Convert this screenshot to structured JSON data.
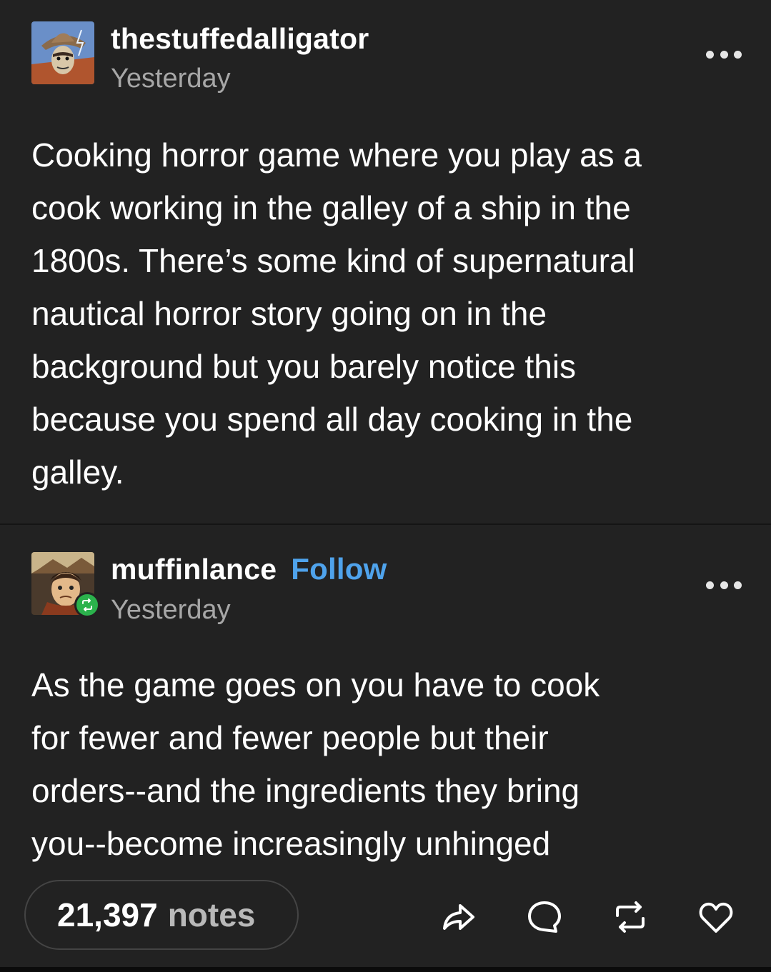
{
  "posts": [
    {
      "username": "thestuffedalligator",
      "timestamp": "Yesterday",
      "avatar_icon": "cowboy-avatar",
      "body": "Cooking horror game where you play as a\ncook working in the galley of a ship in the\n1800s. There’s some kind of supernatural\nnautical horror story going on in the\nbackground but you barely notice this\nbecause you spend all day cooking in the\ngalley."
    },
    {
      "username": "muffinlance",
      "follow_label": "Follow",
      "timestamp": "Yesterday",
      "avatar_icon": "cartoon-character-avatar",
      "badge_icon": "reblog-badge-icon",
      "body": "As the game goes on you have to cook\nfor fewer and fewer people but their\norders--and the ingredients they bring\nyou--become increasingly unhinged"
    }
  ],
  "footer": {
    "notes_count": "21,397",
    "notes_label": "notes",
    "actions": [
      "share-icon",
      "reply-icon",
      "reblog-icon",
      "like-icon"
    ]
  },
  "colors": {
    "background": "#222222",
    "text": "#ffffff",
    "muted": "#a7a7a7",
    "follow": "#4fa3ec",
    "reblog_badge": "#2bb24c"
  }
}
